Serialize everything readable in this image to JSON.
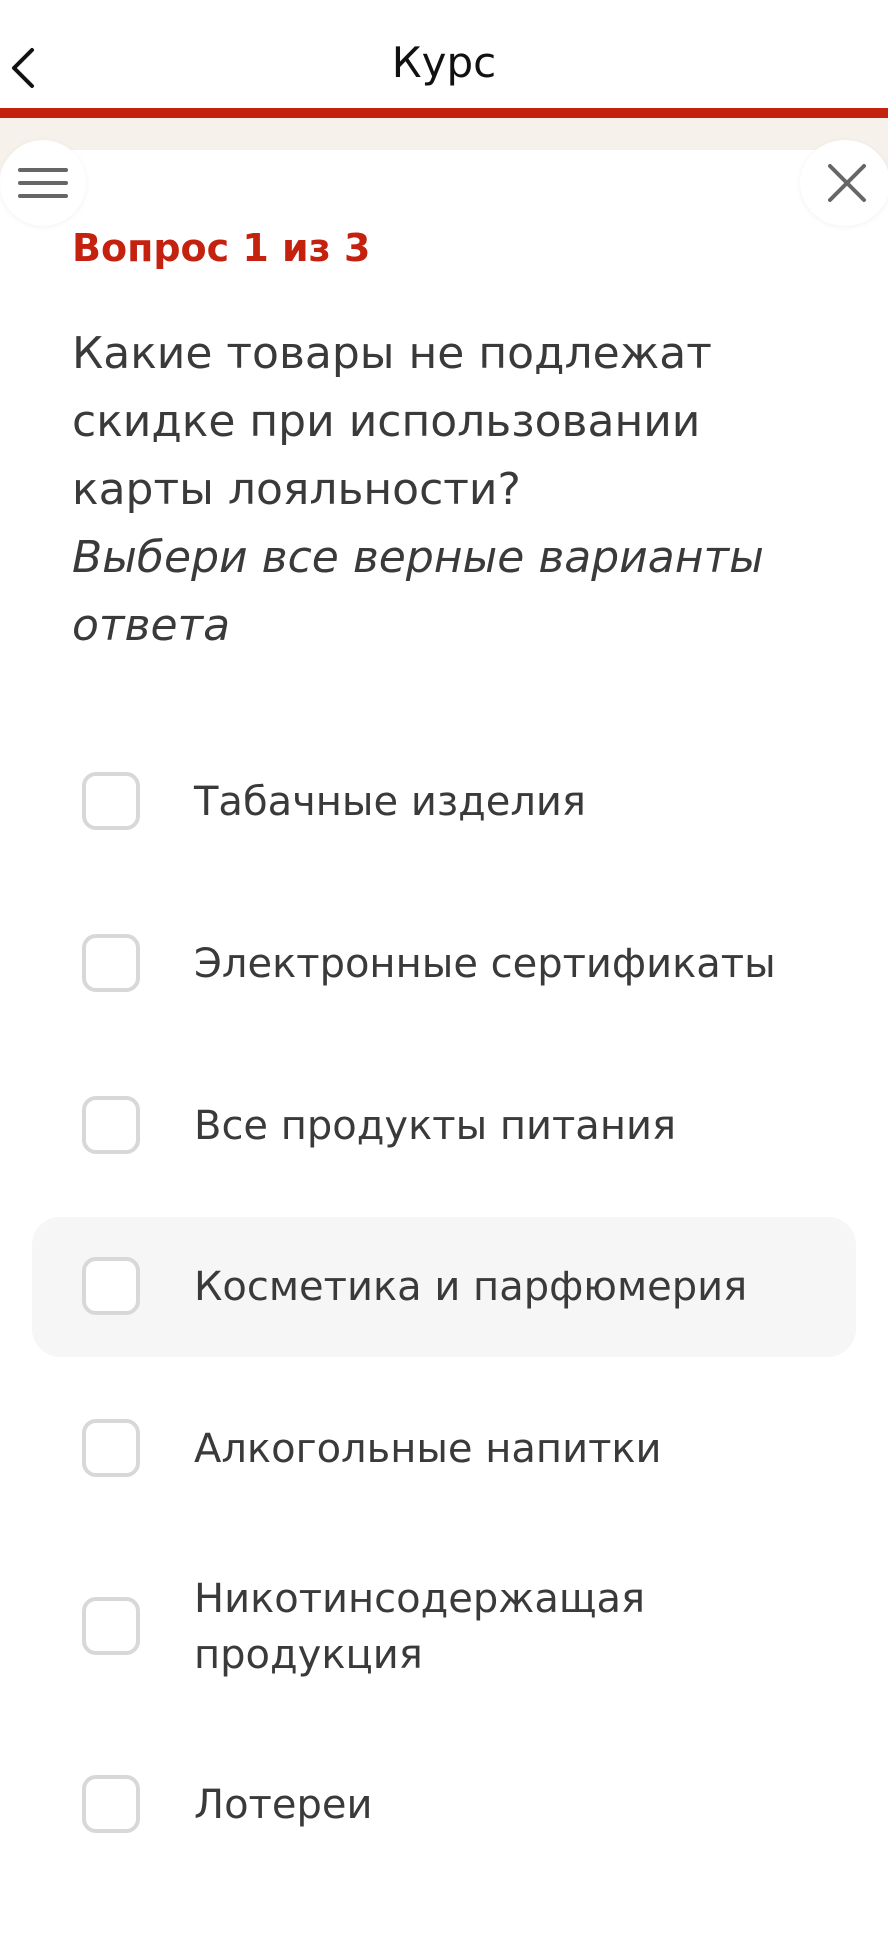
{
  "header": {
    "title": "Курс"
  },
  "question": {
    "counter": "Вопрос 1 из 3",
    "text": "Какие товары не подлежат скидке при использовании карты лояльности?",
    "hint": "Выбери все верные варианты ответа"
  },
  "options": [
    {
      "label": "Табачные изделия",
      "checked": false
    },
    {
      "label": "Электронные сертификаты",
      "checked": false
    },
    {
      "label": "Все продукты питания",
      "checked": false
    },
    {
      "label": "Косметика и парфюмерия",
      "checked": false
    },
    {
      "label": "Алкогольные напитки",
      "checked": false
    },
    {
      "label": "Никотинсодержащая продукция",
      "checked": false
    },
    {
      "label": "Лотереи",
      "checked": false
    }
  ],
  "colors": {
    "accent": "#c4210f",
    "strip": "#f7f1eb",
    "hover": "#f6f6f6"
  },
  "icons": {
    "back": "chevron-left-icon",
    "menu": "menu-icon",
    "close": "close-icon"
  }
}
